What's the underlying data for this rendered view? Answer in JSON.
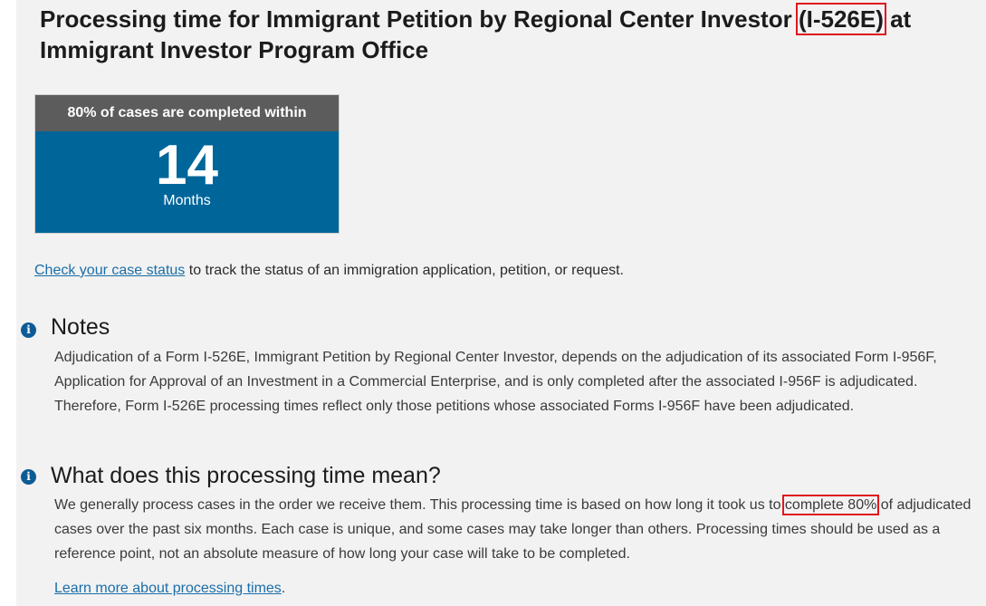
{
  "title": {
    "prefix": "Processing time for Immigrant Petition by Regional Center Investor ",
    "form": "(I-526E)",
    "suffix": " at Immigrant Investor Program Office"
  },
  "card": {
    "header": "80% of cases are completed within",
    "value": "14",
    "unit": "Months"
  },
  "status": {
    "link": "Check your case status",
    "text": " to track the status of an immigration application, petition, or request."
  },
  "notes": {
    "icon": "info-icon",
    "heading": "Notes",
    "body": "Adjudication of a Form I-526E, Immigrant Petition by Regional Center Investor, depends on the adjudication of its associated Form I-956F, Application for Approval of an Investment in a Commercial Enterprise, and is only completed after the associated I-956F is adjudicated. Therefore, Form I-526E processing times reflect only those petitions whose associated Forms I-956F have been adjudicated."
  },
  "meaning": {
    "icon": "info-icon",
    "heading": "What does this processing time mean?",
    "body_a": "We generally process cases in the order we receive them. This processing time is based on how long it took us to ",
    "highlight": "complete 80%",
    "body_b": " of adjudicated cases over the past six months. Each case is unique, and some cases may take longer than others. Processing times should be used as a reference point, not an absolute measure of how long your case will take to be completed."
  },
  "learn": {
    "link": "Learn more about processing times",
    "suffix": "."
  },
  "colors": {
    "card_header": "#5c5c5c",
    "card_body": "#00669a",
    "highlight_box": "#e0161b",
    "link": "#1a6ea8"
  }
}
